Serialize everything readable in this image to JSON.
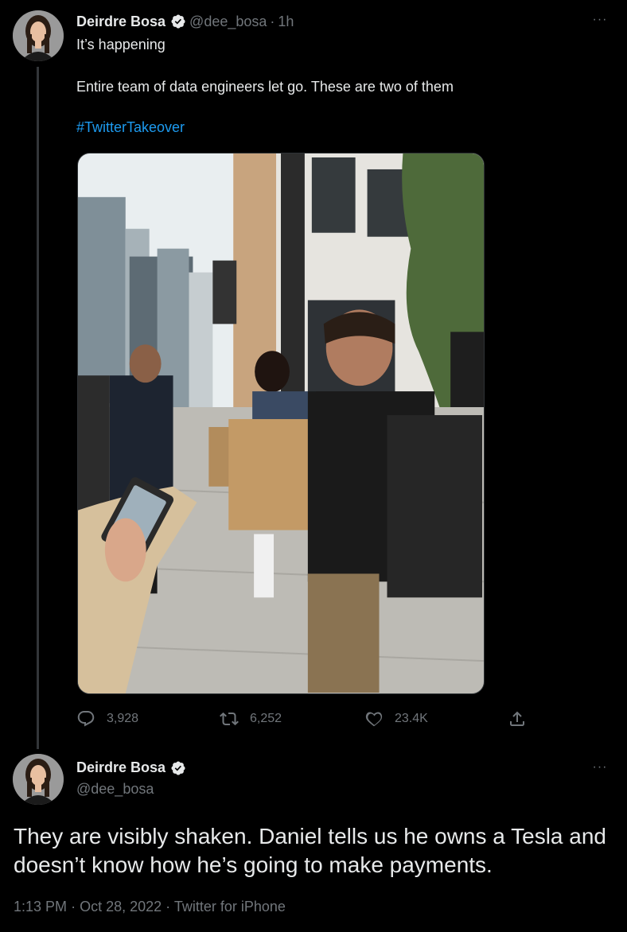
{
  "tweet1": {
    "author_name": "Deirdre Bosa",
    "handle": "@dee_bosa",
    "separator": "·",
    "time_ago": "1h",
    "more_label": "···",
    "line1": "It’s happening",
    "line2": "Entire team of data engineers let go. These are two of them",
    "hashtag": "#TwitterTakeover",
    "reply_count": "3,928",
    "retweet_count": "6,252",
    "like_count": "23.4K"
  },
  "tweet2": {
    "author_name": "Deirdre Bosa",
    "handle": "@dee_bosa",
    "more_label": "···",
    "text": "They are visibly shaken. Daniel tells us he owns a Tesla and doesn’t know how he’s going to make payments.",
    "time": "1:13 PM",
    "separator1": "·",
    "date": "Oct 28, 2022",
    "separator2": "·",
    "source": "Twitter for iPhone"
  },
  "icons": {
    "verified": "verified-badge-icon",
    "reply": "reply-icon",
    "retweet": "retweet-icon",
    "like": "heart-icon",
    "share": "share-icon"
  },
  "colors": {
    "background": "#000000",
    "text": "#e7e9ea",
    "muted": "#71767b",
    "link": "#1d9bf0"
  }
}
